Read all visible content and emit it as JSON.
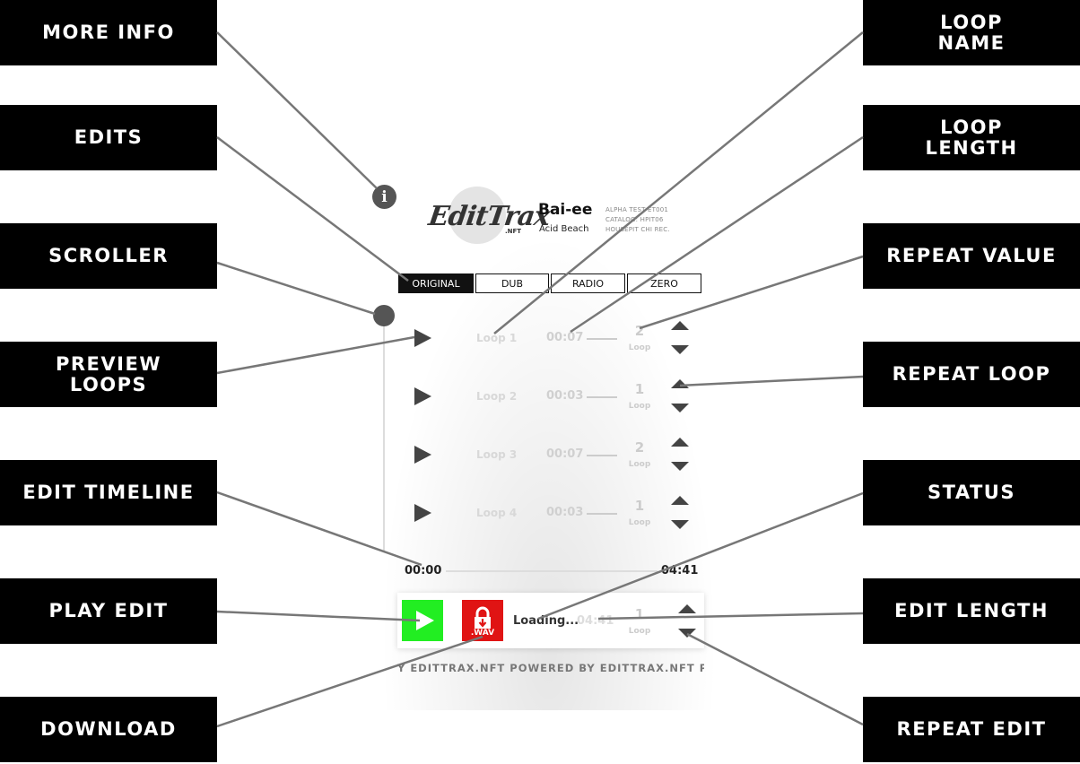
{
  "labels_left": [
    "MORE INFO",
    "EDITS",
    "SCROLLER",
    "PREVIEW\nLOOPS",
    "EDIT  TIMELINE",
    "PLAY  EDIT",
    "DOWNLOAD"
  ],
  "labels_right": [
    "LOOP\nNAME",
    "LOOP\nLENGTH",
    "REPEAT  VALUE",
    "REPEAT  LOOP",
    "STATUS",
    "EDIT  LENGTH",
    "REPEAT  EDIT"
  ],
  "player": {
    "info_glyph": "i",
    "logo_text": "EditTrax",
    "logo_sub": ".NFT",
    "track_title": "Bai-ee",
    "track_artist": "Acid Beach",
    "meta": [
      "ALPHA TEST ET001",
      "CATALOG: HPIT06",
      "HOUSEPIT CHI REC."
    ],
    "tabs": [
      "ORIGINAL",
      "DUB",
      "RADIO",
      "ZERO"
    ],
    "active_tab": "ORIGINAL",
    "loops": [
      {
        "name": "Loop 1",
        "length": "00:07",
        "repeat": "2",
        "repeat_label": "Loop"
      },
      {
        "name": "Loop 2",
        "length": "00:03",
        "repeat": "1",
        "repeat_label": "Loop"
      },
      {
        "name": "Loop 3",
        "length": "00:07",
        "repeat": "2",
        "repeat_label": "Loop"
      },
      {
        "name": "Loop 4",
        "length": "00:03",
        "repeat": "1",
        "repeat_label": "Loop"
      }
    ],
    "timeline_start": "00:00",
    "timeline_end": "04:41",
    "download_label": ".WAV",
    "status": "Loading...",
    "edit_length": "04:41",
    "edit_repeat": "1",
    "edit_repeat_label": "Loop",
    "ticker": "Y EDITTRAX.NFT  POWERED BY EDITTRAX.NFT  POWI"
  },
  "colors": {
    "label_bg": "#000000",
    "play_button": "#22ee22",
    "download_button": "#e01414",
    "connector": "#777777"
  }
}
